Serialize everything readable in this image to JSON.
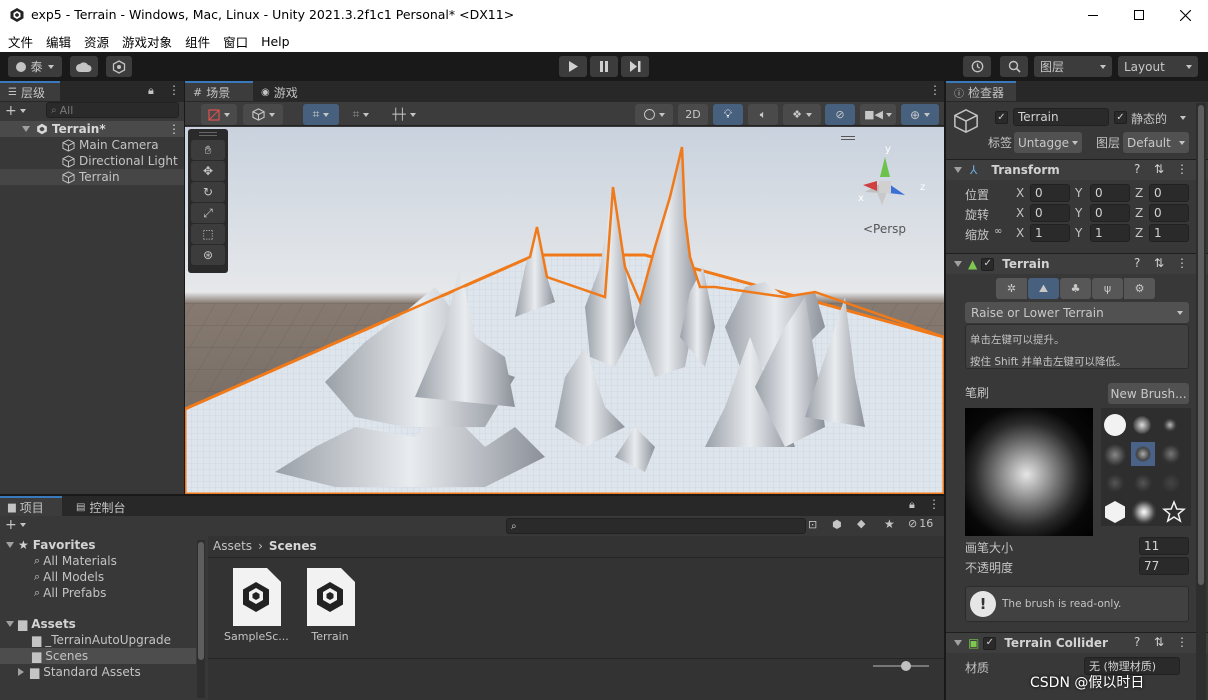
{
  "window": {
    "title": "exp5 - Terrain - Windows, Mac, Linux - Unity 2021.3.2f1c1 Personal* <DX11>"
  },
  "menu": [
    "文件",
    "编辑",
    "资源",
    "游戏对象",
    "组件",
    "窗口",
    "Help"
  ],
  "toolbar": {
    "account_label": "泰",
    "layers_label": "图层",
    "layout_label": "Layout"
  },
  "hierarchy": {
    "tab_label": "层级",
    "search_placeholder": "All",
    "scene_name": "Terrain*",
    "items": [
      "Main Camera",
      "Directional Light",
      "Terrain"
    ]
  },
  "scene_view": {
    "tabs": [
      "场景",
      "游戏"
    ],
    "mode_2d": "2D",
    "persp_label": "<Persp",
    "gizmo_labels": [
      "y",
      "x",
      "z"
    ]
  },
  "project": {
    "tabs": [
      "项目",
      "控制台"
    ],
    "hidden_count": "16",
    "favorites_label": "Favorites",
    "favorites": [
      "All Materials",
      "All Models",
      "All Prefabs"
    ],
    "assets_label": "Assets",
    "assets": [
      "_TerrainAutoUpgrade",
      "Scenes",
      "Standard Assets"
    ],
    "breadcrumb": [
      "Assets",
      "Scenes"
    ],
    "files": [
      "SampleSc...",
      "Terrain"
    ]
  },
  "inspector": {
    "tab_label": "检查器",
    "object_name": "Terrain",
    "static_label": "静态的",
    "tag_label": "标签",
    "tag_value": "Untagge",
    "layer_label": "图层",
    "layer_value": "Default",
    "transform": {
      "title": "Transform",
      "rows": [
        {
          "label": "位置",
          "x": "0",
          "y": "0",
          "z": "0"
        },
        {
          "label": "旋转",
          "x": "0",
          "y": "0",
          "z": "0"
        },
        {
          "label": "缩放",
          "x": "1",
          "y": "1",
          "z": "1"
        }
      ],
      "axis": [
        "X",
        "Y",
        "Z"
      ]
    },
    "terrain": {
      "title": "Terrain",
      "tool_dropdown": "Raise or Lower Terrain",
      "help_line1": "单击左键可以提升。",
      "help_line2": "按住 Shift 并单击左键可以降低。",
      "brush_label": "笔刷",
      "new_brush": "New Brush...",
      "brush_size_label": "画笔大小",
      "brush_size": "11",
      "opacity_label": "不透明度",
      "opacity": "77",
      "readonly_note": "The brush is read-only."
    },
    "collider": {
      "title": "Terrain Collider",
      "material_label": "材质",
      "material_value": "无 (物理材质)"
    }
  },
  "watermark": "CSDN @假以时日"
}
